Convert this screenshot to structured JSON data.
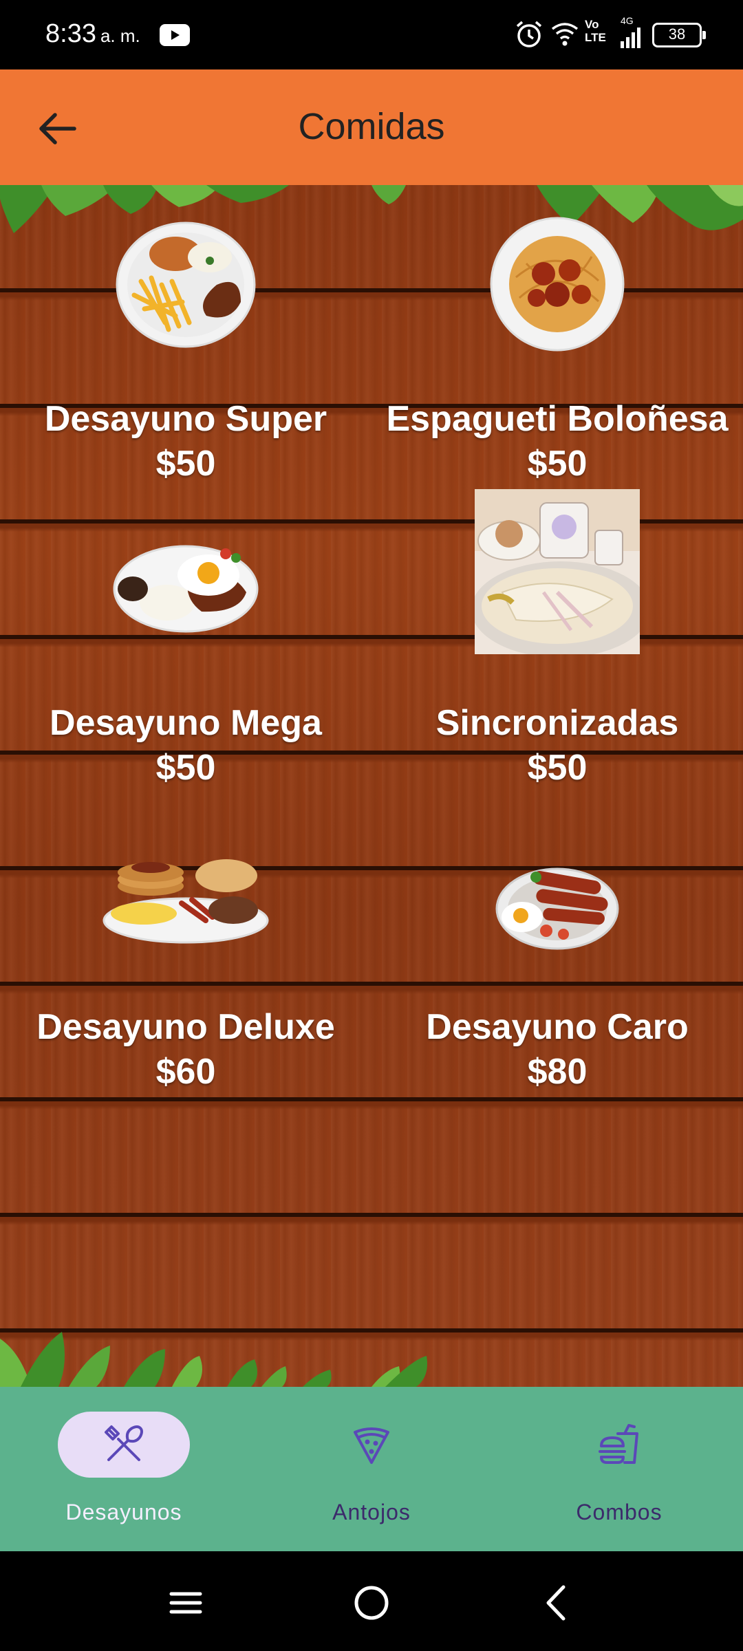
{
  "status_bar": {
    "time": "8:33",
    "ampm": "a. m.",
    "network": "Vo LTE",
    "network_4g": "4G",
    "battery": "38"
  },
  "app_bar": {
    "title": "Comidas"
  },
  "products": [
    {
      "name": "Desayuno Super",
      "price": "$50",
      "image_icon": "plate-fries-steak-icon"
    },
    {
      "name": "Espagueti Boloñesa",
      "price": "$50",
      "image_icon": "plate-spaghetti-icon"
    },
    {
      "name": "Desayuno Mega",
      "price": "$50",
      "image_icon": "plate-egg-steak-icon"
    },
    {
      "name": "Sincronizadas",
      "price": "$50",
      "image_icon": "sincronizadas-photo-icon"
    },
    {
      "name": "Desayuno Deluxe",
      "price": "$60",
      "image_icon": "plate-pancakes-icon"
    },
    {
      "name": "Desayuno Caro",
      "price": "$80",
      "image_icon": "plate-sausages-icon"
    }
  ],
  "bottom_nav": {
    "items": [
      {
        "label": "Desayunos",
        "icon": "utensils-icon",
        "active": true
      },
      {
        "label": "Antojos",
        "icon": "pizza-icon",
        "active": false
      },
      {
        "label": "Combos",
        "icon": "burger-drink-icon",
        "active": false
      }
    ]
  },
  "colors": {
    "app_bar": "#f07634",
    "wood": "#8d3813",
    "bottom_nav": "#5cb28d",
    "active_pill": "#e8ddf7",
    "nav_label": "#3c2a6b"
  }
}
